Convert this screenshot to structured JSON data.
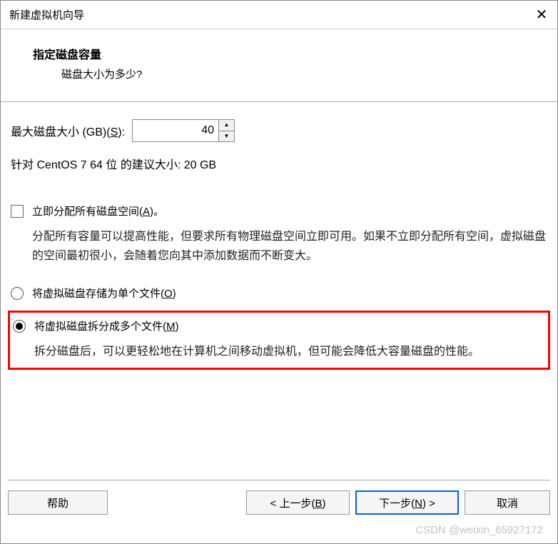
{
  "titlebar": {
    "title": "新建虚拟机向导"
  },
  "header": {
    "title": "指定磁盘容量",
    "subtitle": "磁盘大小为多少?"
  },
  "disk_size": {
    "label_prefix": "最大磁盘大小 (GB)(",
    "label_hotkey": "S",
    "label_suffix": "):",
    "value": "40",
    "recommended": "针对 CentOS 7 64 位 的建议大小: 20 GB"
  },
  "allocate_now": {
    "label_prefix": "立即分配所有磁盘空间(",
    "label_hotkey": "A",
    "label_suffix": ")。",
    "info": "分配所有容量可以提高性能，但要求所有物理磁盘空间立即可用。如果不立即分配所有空间，虚拟磁盘的空间最初很小，会随着您向其中添加数据而不断变大。"
  },
  "radio_single": {
    "label_prefix": "将虚拟磁盘存储为单个文件(",
    "label_hotkey": "O",
    "label_suffix": ")"
  },
  "radio_split": {
    "label_prefix": "将虚拟磁盘拆分成多个文件(",
    "label_hotkey": "M",
    "label_suffix": ")",
    "info": "拆分磁盘后，可以更轻松地在计算机之间移动虚拟机，但可能会降低大容量磁盘的性能。"
  },
  "buttons": {
    "help": "帮助",
    "back_prefix": "< 上一步(",
    "back_hotkey": "B",
    "back_suffix": ")",
    "next_prefix": "下一步(",
    "next_hotkey": "N",
    "next_suffix": ") >",
    "cancel": "取消"
  },
  "watermark": "CSDN @weixin_65927172"
}
